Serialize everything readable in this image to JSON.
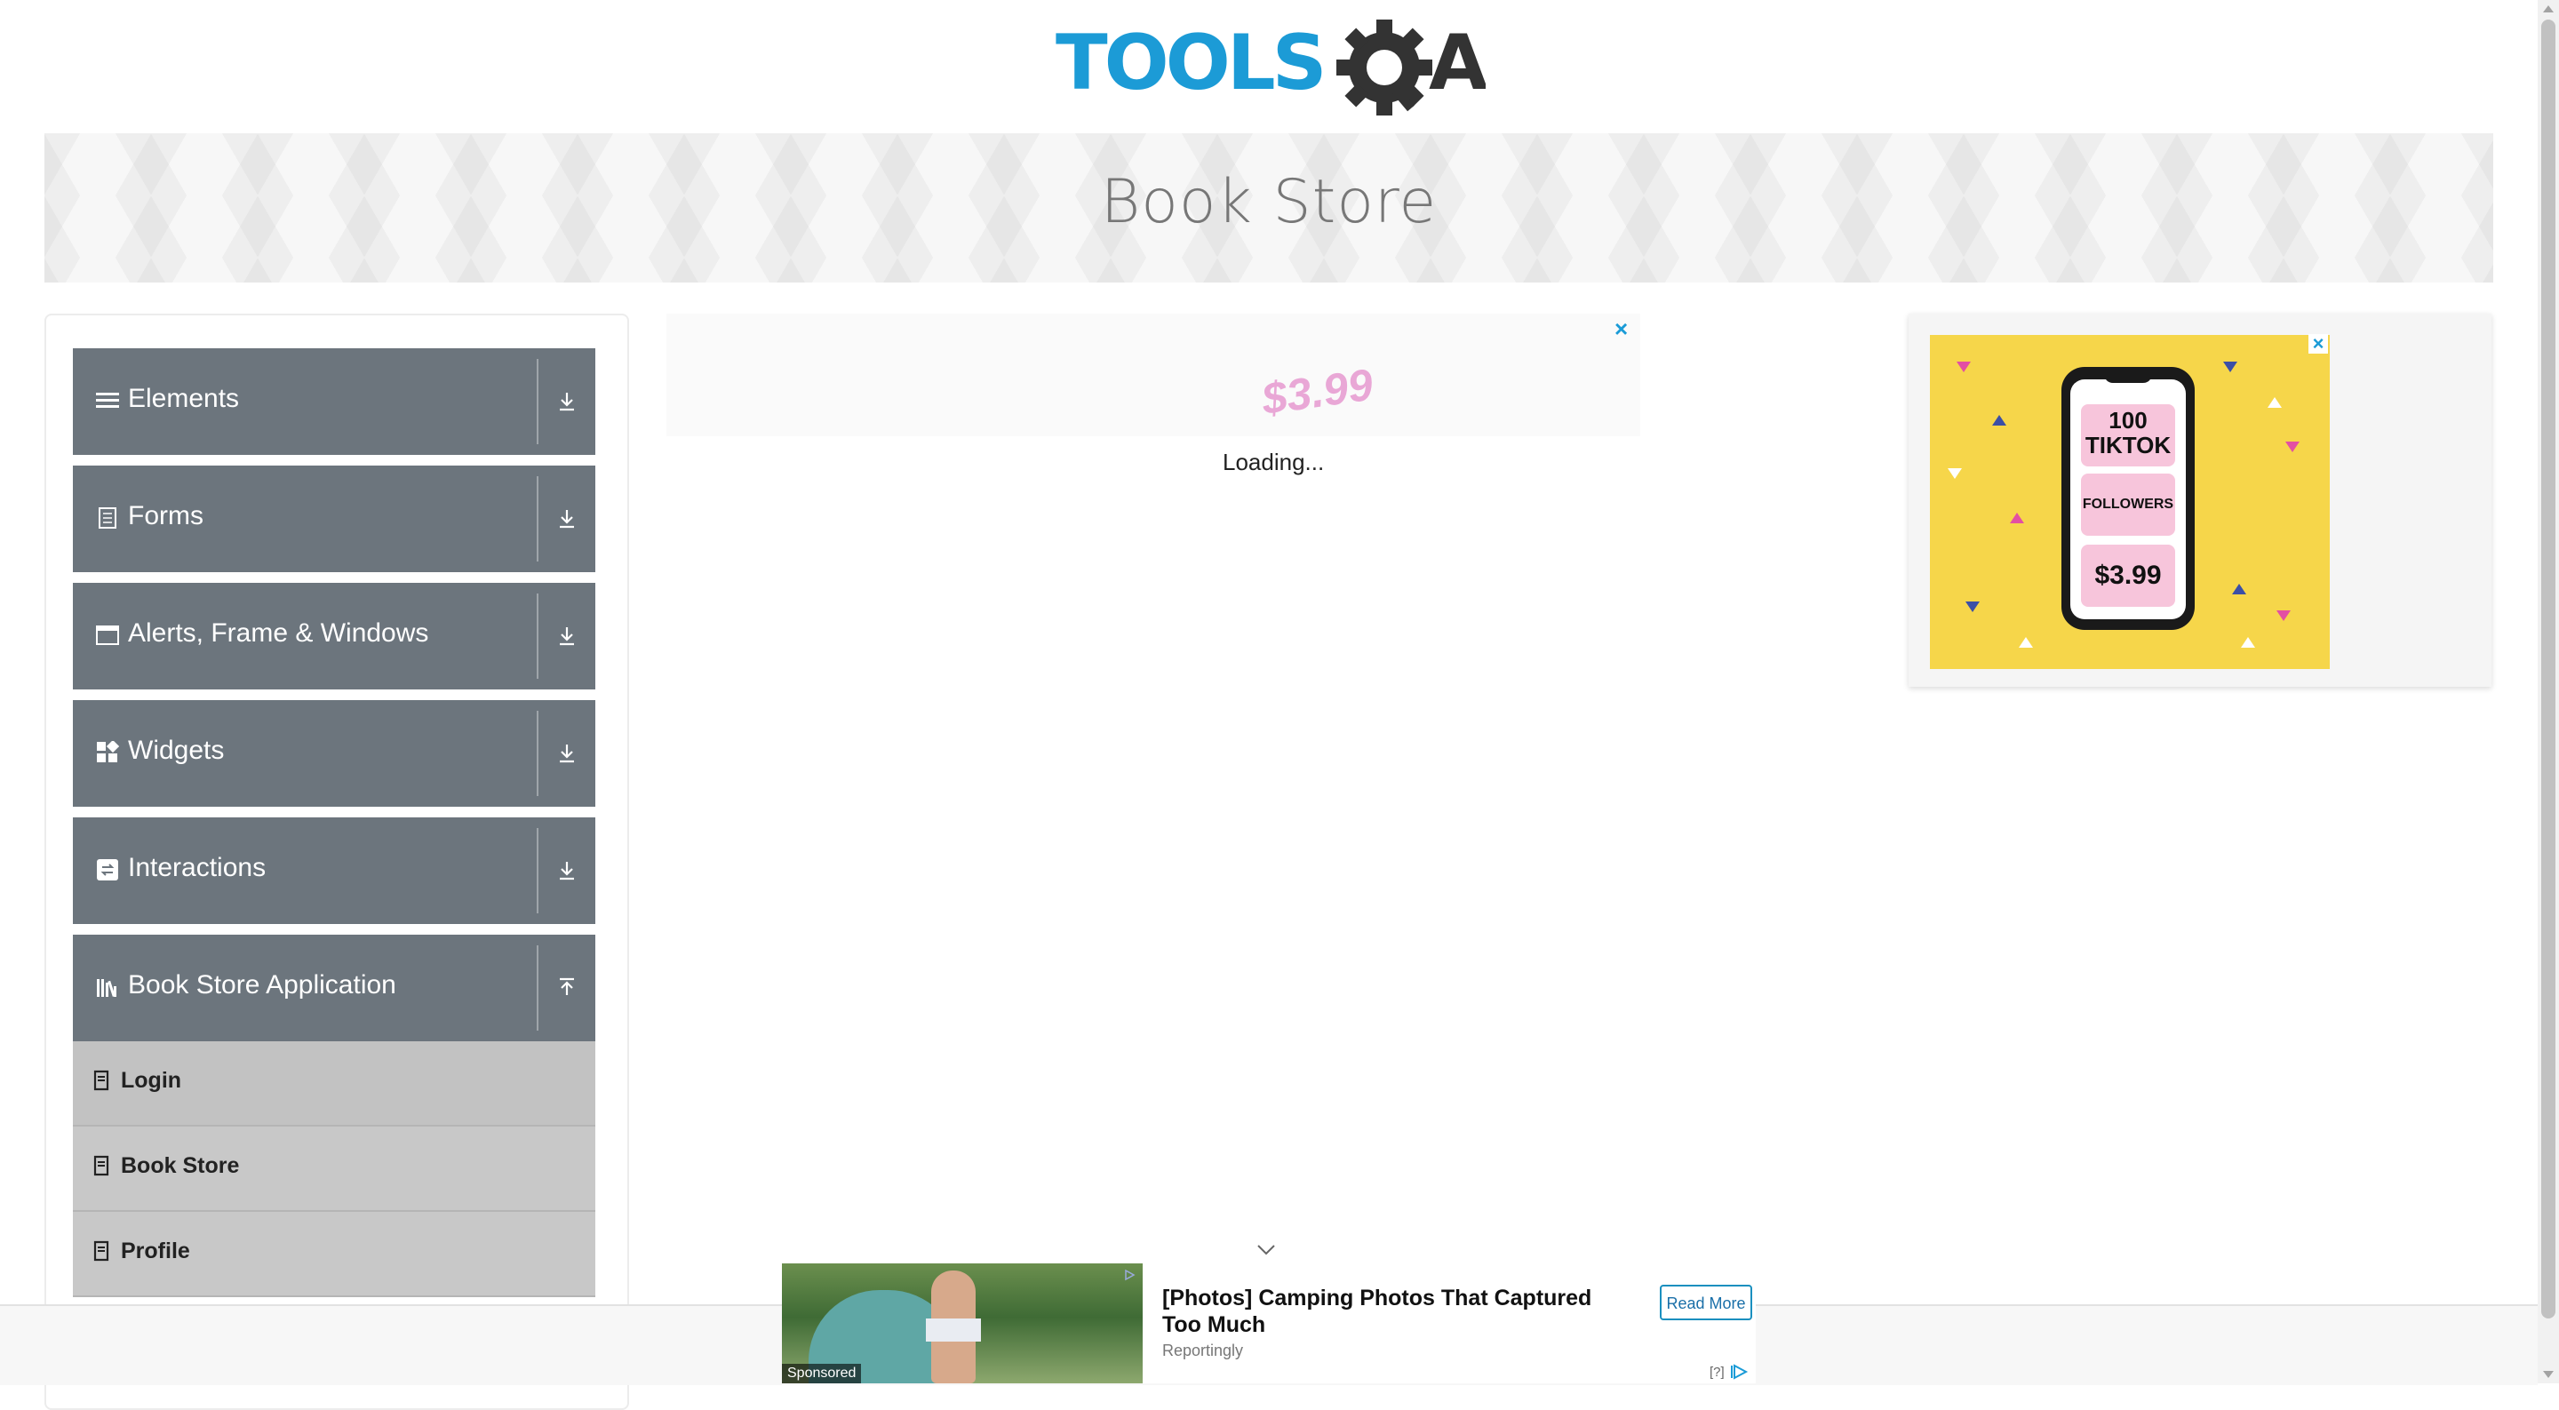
{
  "header": {
    "logo_text": "TOOLSQA",
    "logo_alt": "ToolsQA logo"
  },
  "banner": {
    "title": "Book Store"
  },
  "sidebar": {
    "groups": [
      {
        "label": "Elements",
        "icon": "list-icon",
        "expanded": false
      },
      {
        "label": "Forms",
        "icon": "form-icon",
        "expanded": false
      },
      {
        "label": "Alerts, Frame & Windows",
        "icon": "window-icon",
        "expanded": false
      },
      {
        "label": "Widgets",
        "icon": "widgets-icon",
        "expanded": false
      },
      {
        "label": "Interactions",
        "icon": "interactions-icon",
        "expanded": false
      },
      {
        "label": "Book Store Application",
        "icon": "library-icon",
        "expanded": true
      }
    ],
    "subitems": [
      {
        "label": "Login",
        "icon": "document-icon"
      },
      {
        "label": "Book Store",
        "icon": "document-icon"
      },
      {
        "label": "Profile",
        "icon": "document-icon"
      }
    ]
  },
  "center_ad": {
    "price": "$3.99",
    "close": "×",
    "loading": "Loading..."
  },
  "right_ad": {
    "close": "×",
    "line1": "100",
    "line2": "TIKTOK",
    "line3": "FOLLOWERS",
    "price": "$3.99",
    "background": "#f6d64a"
  },
  "bottom_ad": {
    "sponsored": "Sponsored",
    "headline": "[Photos] Camping Photos That Captured Too Much",
    "source": "Reportingly",
    "cta": "Read More",
    "help": "[?]"
  },
  "colors": {
    "accent": "#1a9bd7",
    "group_bg": "#6c757d",
    "subitem_bg": "#c8c8c8"
  }
}
